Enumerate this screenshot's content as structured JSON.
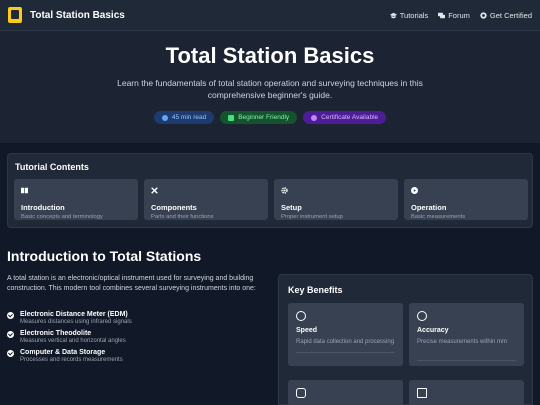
{
  "header": {
    "title": "Total Station Basics",
    "nav": [
      {
        "label": "Tutorials",
        "icon": "graduation-cap-icon"
      },
      {
        "label": "Forum",
        "icon": "chat-icon"
      },
      {
        "label": "Get Certified",
        "icon": "certificate-icon"
      }
    ]
  },
  "hero": {
    "title": "Total Station Basics",
    "subtitle": "Learn the fundamentals of total station operation and surveying techniques in this comprehensive beginner's guide.",
    "badges": [
      {
        "label": "45 min read",
        "color": "#60a5fa"
      },
      {
        "label": "Beginner Friendly",
        "color": "#4ade80"
      },
      {
        "label": "Certificate Available",
        "color": "#c084fc"
      }
    ]
  },
  "contents": {
    "title": "Tutorial Contents",
    "items": [
      {
        "title": "Introduction",
        "desc": "Basic concepts and terminology",
        "icon": "book-icon"
      },
      {
        "title": "Components",
        "desc": "Parts and their functions",
        "icon": "tools-icon"
      },
      {
        "title": "Setup",
        "desc": "Proper instrument setup",
        "icon": "gear-icon"
      },
      {
        "title": "Operation",
        "desc": "Basic measurements",
        "icon": "play-icon"
      }
    ]
  },
  "intro": {
    "title": "Introduction to Total Stations",
    "text": "A total station is an electronic/optical instrument used for surveying and building construction. This modern tool combines several surveying instruments into one:",
    "features": [
      {
        "title": "Electronic Distance Meter (EDM)",
        "desc": "Measures distances using infrared signals"
      },
      {
        "title": "Electronic Theodolite",
        "desc": "Measures vertical and horizontal angles"
      },
      {
        "title": "Computer & Data Storage",
        "desc": "Processes and records measurements"
      }
    ]
  },
  "benefits": {
    "title": "Key Benefits",
    "items": [
      {
        "title": "Speed",
        "desc": "Rapid data collection and processing",
        "icon": "speedometer-icon"
      },
      {
        "title": "Accuracy",
        "desc": "Precise measurements within mm",
        "icon": "target-icon"
      },
      {
        "title": "",
        "desc": "",
        "icon": "database-icon"
      },
      {
        "title": "",
        "desc": "",
        "icon": "calculator-icon"
      }
    ]
  }
}
